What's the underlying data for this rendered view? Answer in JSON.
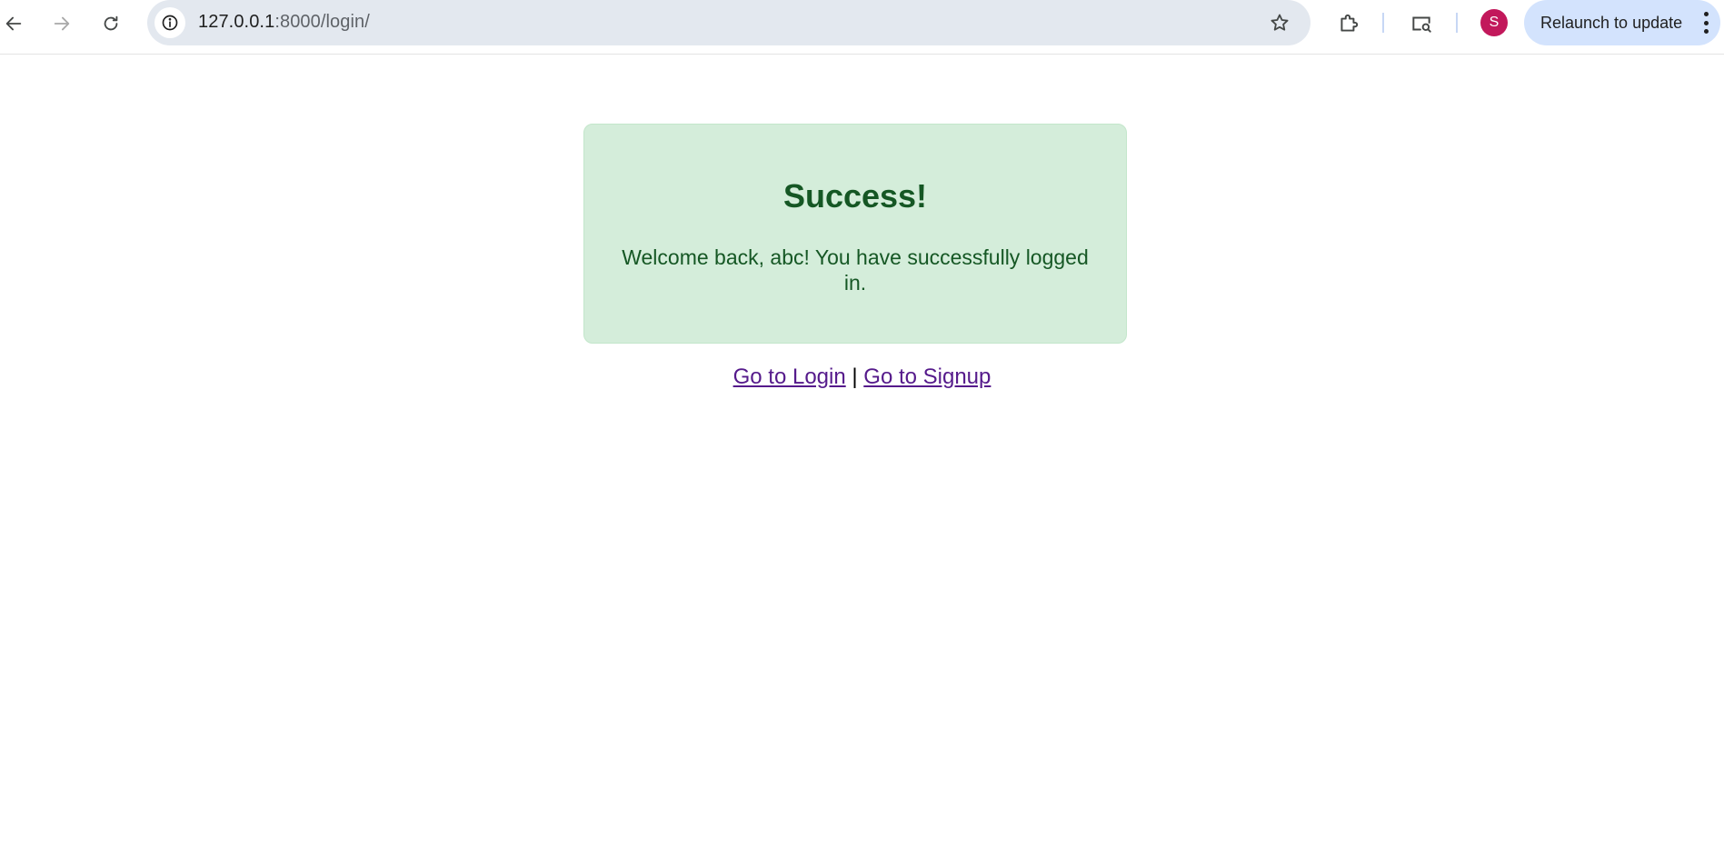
{
  "browser": {
    "url_host": "127.0.0.1",
    "url_path": ":8000/login/",
    "back_icon": "arrow-left-icon",
    "forward_icon": "arrow-right-icon",
    "reload_icon": "reload-icon",
    "site_info_icon": "info-icon",
    "bookmark_icon": "star-icon",
    "extensions_icon": "puzzle-icon",
    "screen_search_icon": "screen-search-icon",
    "profile_initial": "S",
    "profile_color": "#c2185b",
    "relaunch_label": "Relaunch to update",
    "menu_icon": "kebab-menu-icon"
  },
  "page": {
    "title": "Success!",
    "message": "Welcome back, abc! You have successfully logged in.",
    "box_bg": "#d4edda",
    "text_color": "#155724",
    "links": {
      "login_label": "Go to Login",
      "separator": "|",
      "signup_label": "Go to Signup"
    }
  }
}
